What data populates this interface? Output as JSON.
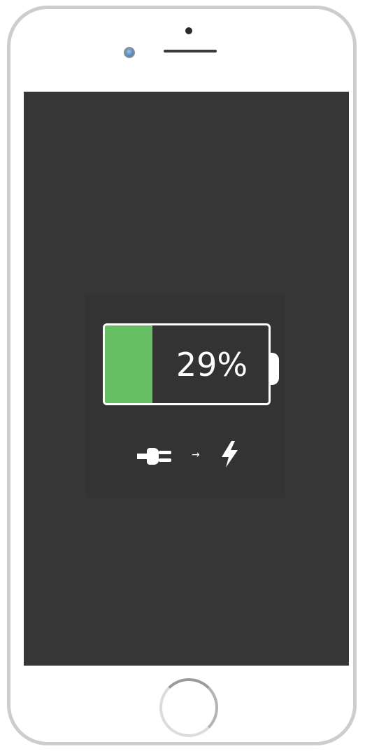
{
  "battery": {
    "percent_label": "29%",
    "level_percent": 29,
    "fill_color": "#67bf63",
    "outline_color": "#ffffff"
  },
  "charging_indicator": {
    "icons": [
      "power-plug-icon",
      "arrow-right-icon",
      "lightning-bolt-icon"
    ],
    "arrow_glyph": "→"
  },
  "device": {
    "type": "smartphone",
    "screen_color": "#363636",
    "frame_color": "#cdcdcd"
  }
}
